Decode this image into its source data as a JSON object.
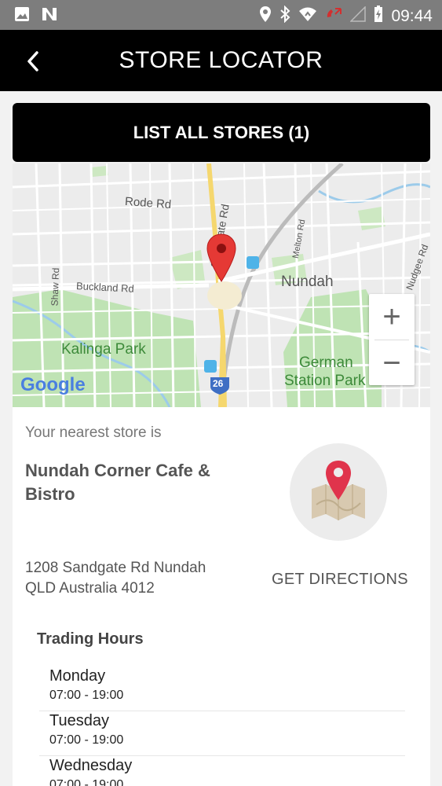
{
  "status_bar": {
    "time": "09:44",
    "icons": [
      "image-icon",
      "n-app-icon",
      "location-icon",
      "bluetooth-icon",
      "wifi-icon",
      "phone-icon",
      "signal-icon",
      "battery-icon"
    ]
  },
  "app_bar": {
    "title": "STORE LOCATOR",
    "back_icon": "chevron-left-icon"
  },
  "list_button": {
    "label": "LIST ALL STORES (1)"
  },
  "map": {
    "labels": {
      "rode_rd": "Rode Rd",
      "sandgate_rd": "Sandgate Rd",
      "buckland_rd": "Buckland Rd",
      "shaw_rd": "Shaw Rd",
      "melton_rd": "Melton Rd",
      "nudgee_rd": "Nudgee Rd",
      "nundah": "Nundah",
      "kalinga_park": "Kalinga Park",
      "german_station_park_1": "German",
      "german_station_park_2": "Station Park",
      "route_26": "26",
      "google": "Google"
    },
    "zoom_in": "+",
    "zoom_out": "−",
    "marker_color": "#e53935"
  },
  "store": {
    "nearest_label": "Your nearest store is",
    "name": "Nundah Corner Cafe & Bistro",
    "address_line1": "1208 Sandgate Rd Nundah",
    "address_line2": "QLD Australia 4012",
    "directions_label": "GET DIRECTIONS"
  },
  "trading_hours": {
    "title": "Trading Hours",
    "days": [
      {
        "day": "Monday",
        "time": "07:00 - 19:00"
      },
      {
        "day": "Tuesday",
        "time": "07:00 - 19:00"
      },
      {
        "day": "Wednesday",
        "time": "07:00 - 19:00"
      }
    ]
  }
}
